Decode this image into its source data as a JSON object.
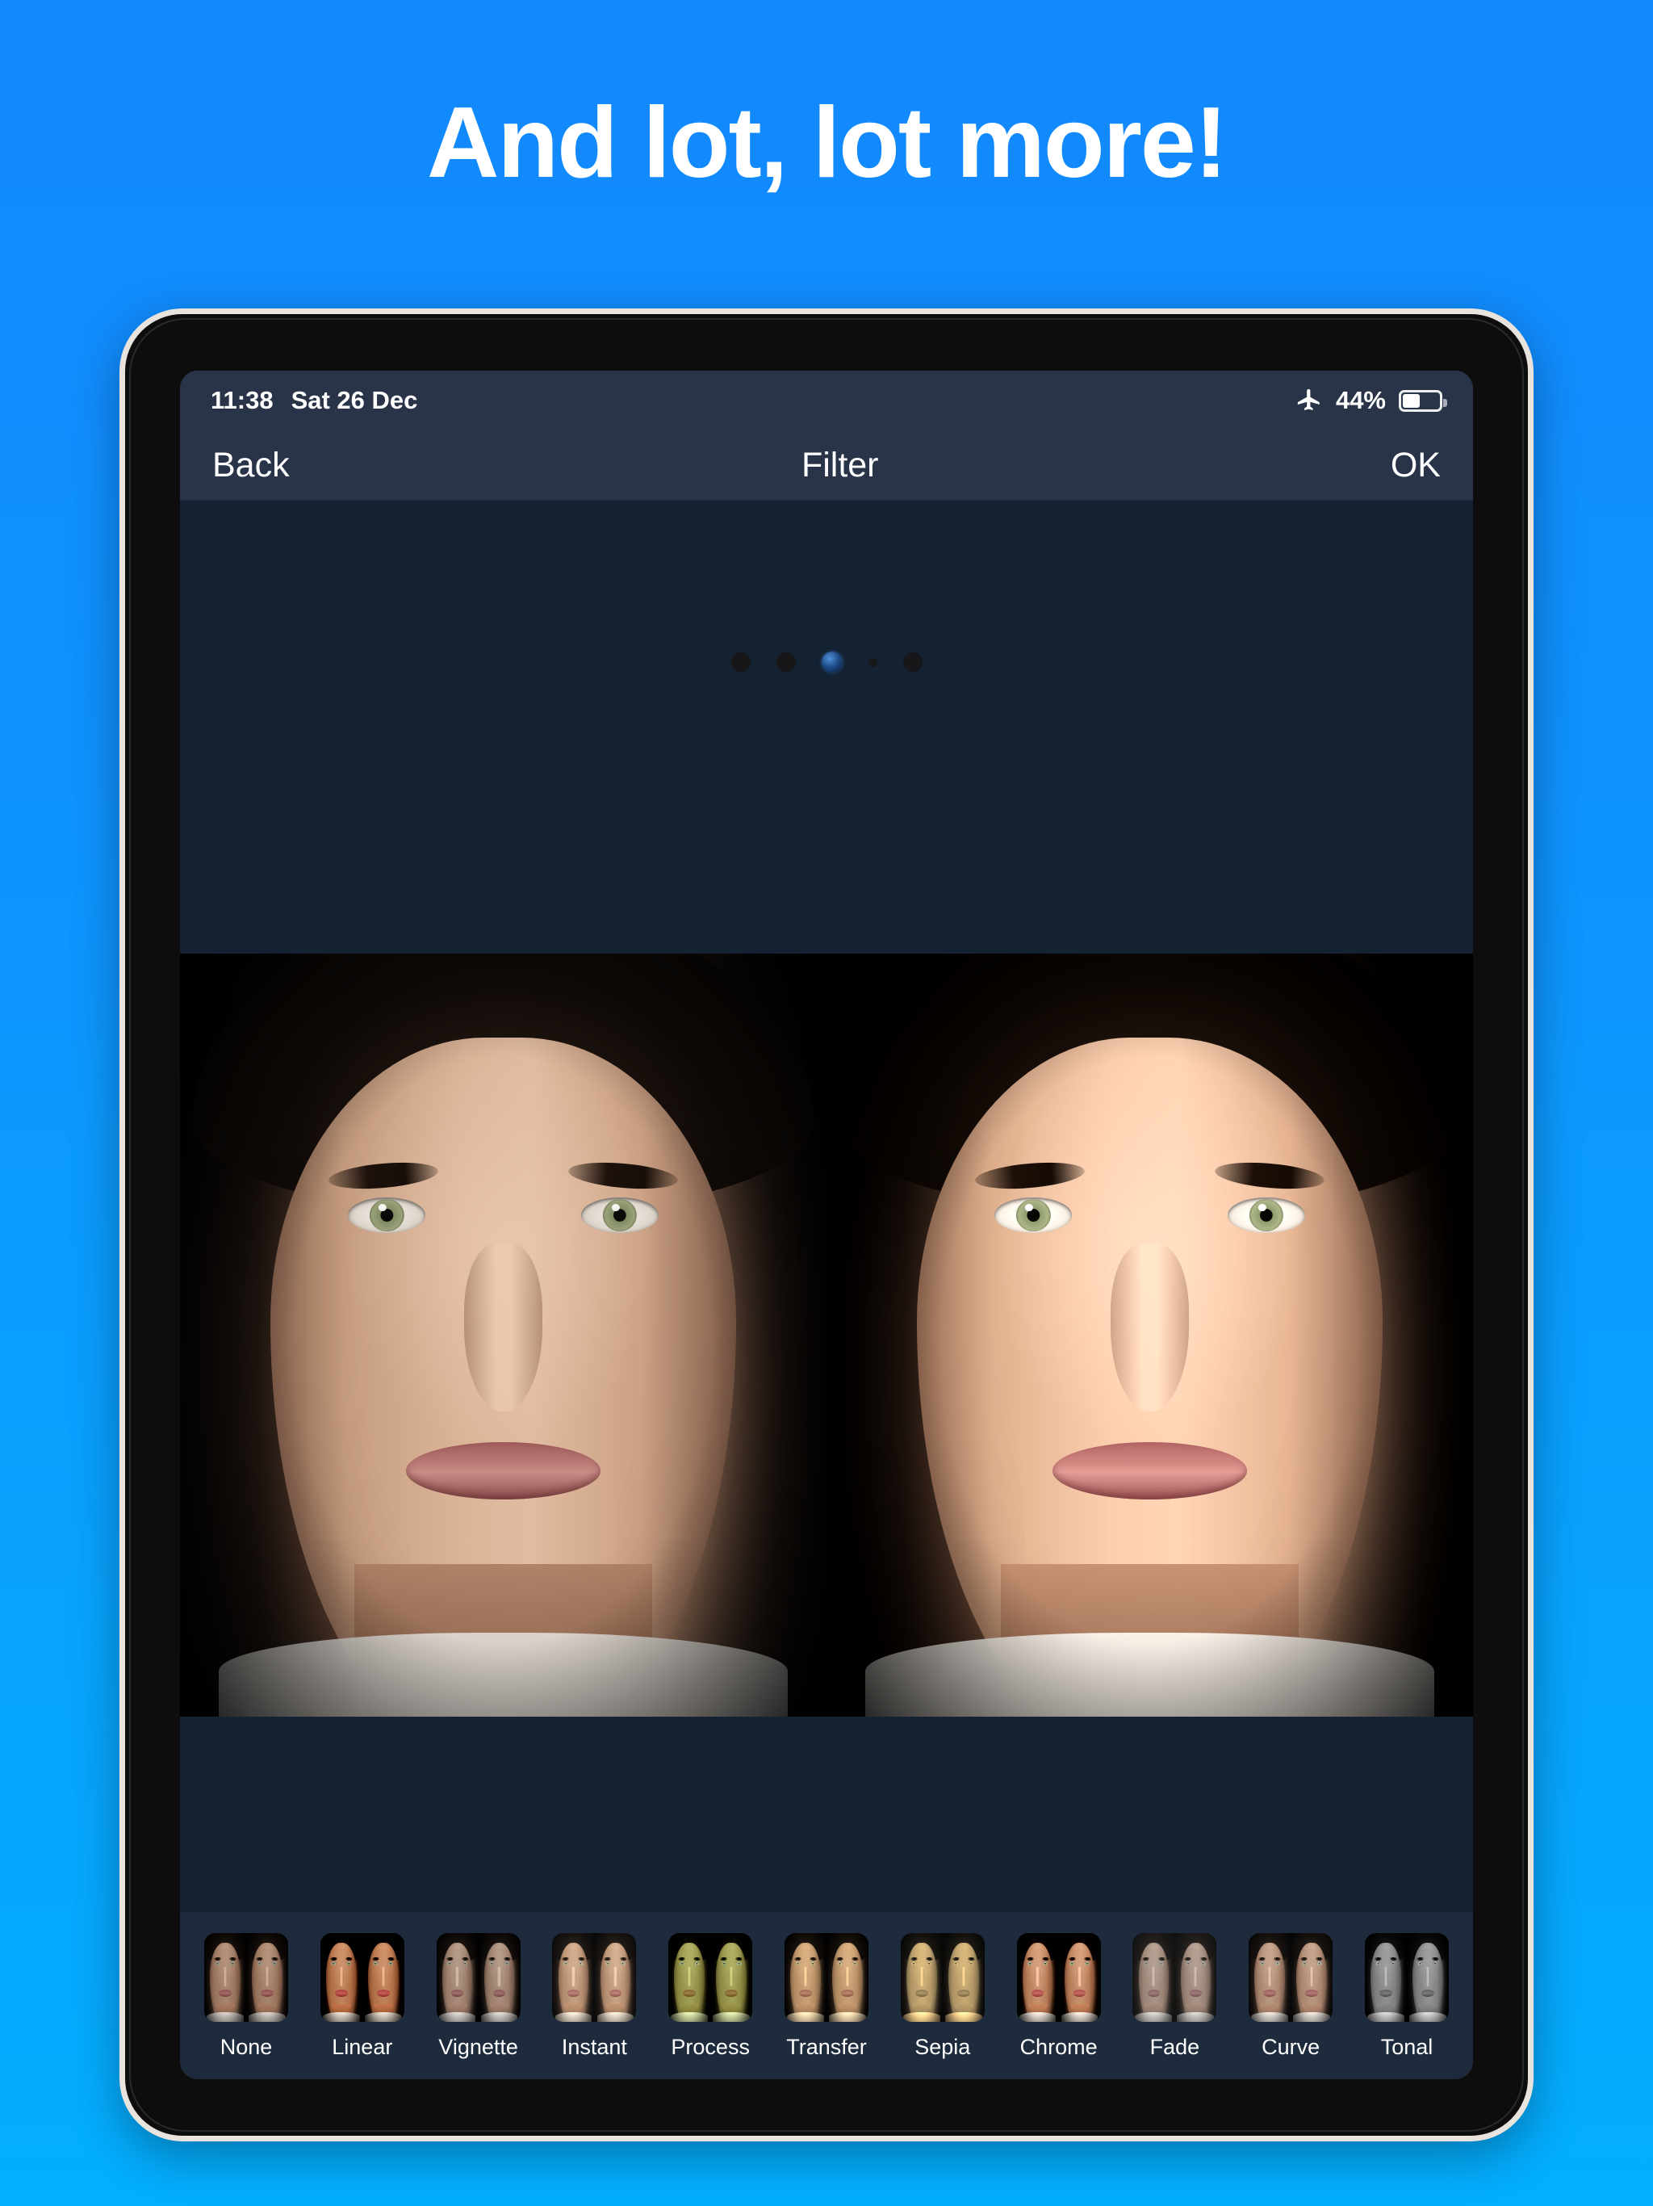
{
  "headline": "And lot, lot more!",
  "theme": {
    "background_top": "#1288fe",
    "background_bottom": "#03aefe",
    "headline_color": "#ffffff",
    "navbar_background": "#2a3448",
    "canvas_background": "#142232",
    "filterbar_background": "#1d2b3d",
    "device_frame": "#e8e3dc",
    "device_bezel": "#0d0d0e"
  },
  "device": {
    "sensors": [
      "sensor-dot",
      "sensor-dot",
      "front-camera-lens",
      "ambient-light-sensor",
      "sensor-dot"
    ],
    "buttons": [
      "power-button",
      "volume-up-button",
      "volume-down-button"
    ]
  },
  "statusbar": {
    "time": "11:38",
    "date": "Sat 26 Dec",
    "airplane_icon": "airplane-icon",
    "battery_percent": "44%",
    "battery_level": 44,
    "battery_icon": "battery-icon"
  },
  "navbar": {
    "back_label": "Back",
    "title": "Filter",
    "ok_label": "OK"
  },
  "preview": {
    "description": "before-after-split-portrait"
  },
  "filters": {
    "selected": "None",
    "items": [
      {
        "label": "None",
        "fx": "fx-none"
      },
      {
        "label": "Linear",
        "fx": "fx-linear"
      },
      {
        "label": "Vignette",
        "fx": "fx-vignette"
      },
      {
        "label": "Instant",
        "fx": "fx-instant"
      },
      {
        "label": "Process",
        "fx": "fx-process"
      },
      {
        "label": "Transfer",
        "fx": "fx-transfer"
      },
      {
        "label": "Sepia",
        "fx": "fx-sepia"
      },
      {
        "label": "Chrome",
        "fx": "fx-chrome"
      },
      {
        "label": "Fade",
        "fx": "fx-fade"
      },
      {
        "label": "Curve",
        "fx": "fx-curve"
      },
      {
        "label": "Tonal",
        "fx": "fx-tonal"
      }
    ]
  }
}
